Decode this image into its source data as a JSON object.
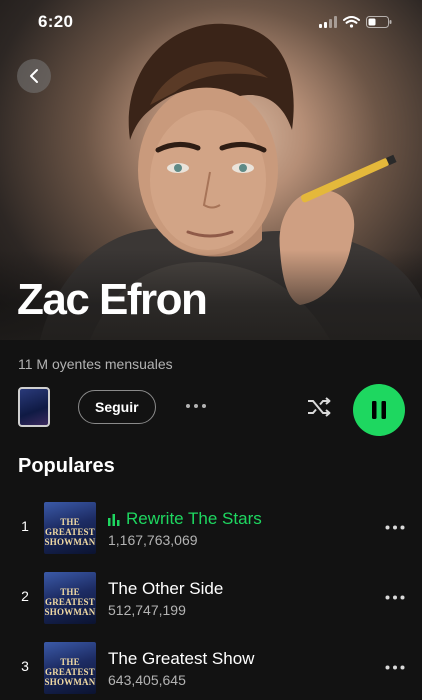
{
  "status_bar": {
    "time": "6:20"
  },
  "artist": {
    "name": "Zac Efron",
    "monthly_listeners": "11 M oyentes mensuales"
  },
  "controls": {
    "follow_label": "Seguir",
    "more_icon": "ellipsis-icon",
    "shuffle_icon": "shuffle-icon",
    "play_state": "playing",
    "accent_color": "#1ed760"
  },
  "popular": {
    "title": "Populares",
    "tracks": [
      {
        "number": "1",
        "title": "Rewrite The Stars",
        "plays": "1,167,763,069",
        "playing": true
      },
      {
        "number": "2",
        "title": "The Other Side",
        "plays": "512,747,199",
        "playing": false
      },
      {
        "number": "3",
        "title": "The Greatest Show",
        "plays": "643,405,645",
        "playing": false
      }
    ]
  }
}
